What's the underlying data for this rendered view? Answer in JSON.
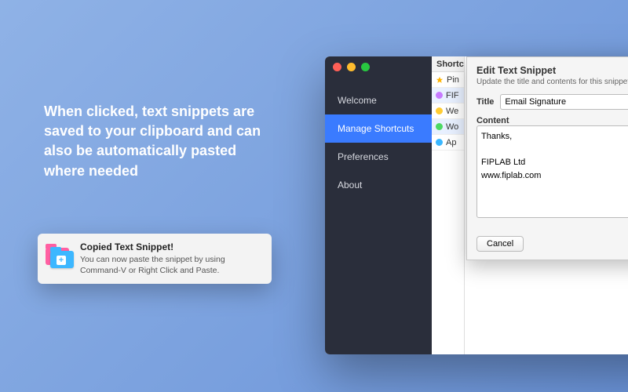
{
  "promo": {
    "headline": "When clicked, text snippets are saved to your clipboard and can also be automatically pasted where needed"
  },
  "toast": {
    "title": "Copied Text Snippet!",
    "body": "You can now paste the snippet by using Command-V or Right Click and Paste."
  },
  "sidebar": {
    "items": [
      {
        "label": "Welcome"
      },
      {
        "label": "Manage Shortcuts"
      },
      {
        "label": "Preferences"
      },
      {
        "label": "About"
      }
    ]
  },
  "snippet_list": {
    "header": "Shortc",
    "rows": [
      {
        "tag_color": "star",
        "label": "Pin"
      },
      {
        "tag_color": "#c77bff",
        "label": "FIF"
      },
      {
        "tag_color": "#ffcc33",
        "label": "We"
      },
      {
        "tag_color": "#4cd964",
        "label": "Wo"
      },
      {
        "tag_color": "#3ab7ff",
        "label": "Ap"
      }
    ]
  },
  "sheet": {
    "heading": "Edit Text Snippet",
    "hint": "Update the title and contents for this snippet, then click the 'Edit' butt",
    "title_label": "Title",
    "title_value": "Email Signature",
    "content_label": "Content",
    "content_value": "Thanks,\n\nFIPLAB Ltd\nwww.fiplab.com",
    "cancel": "Cancel"
  }
}
